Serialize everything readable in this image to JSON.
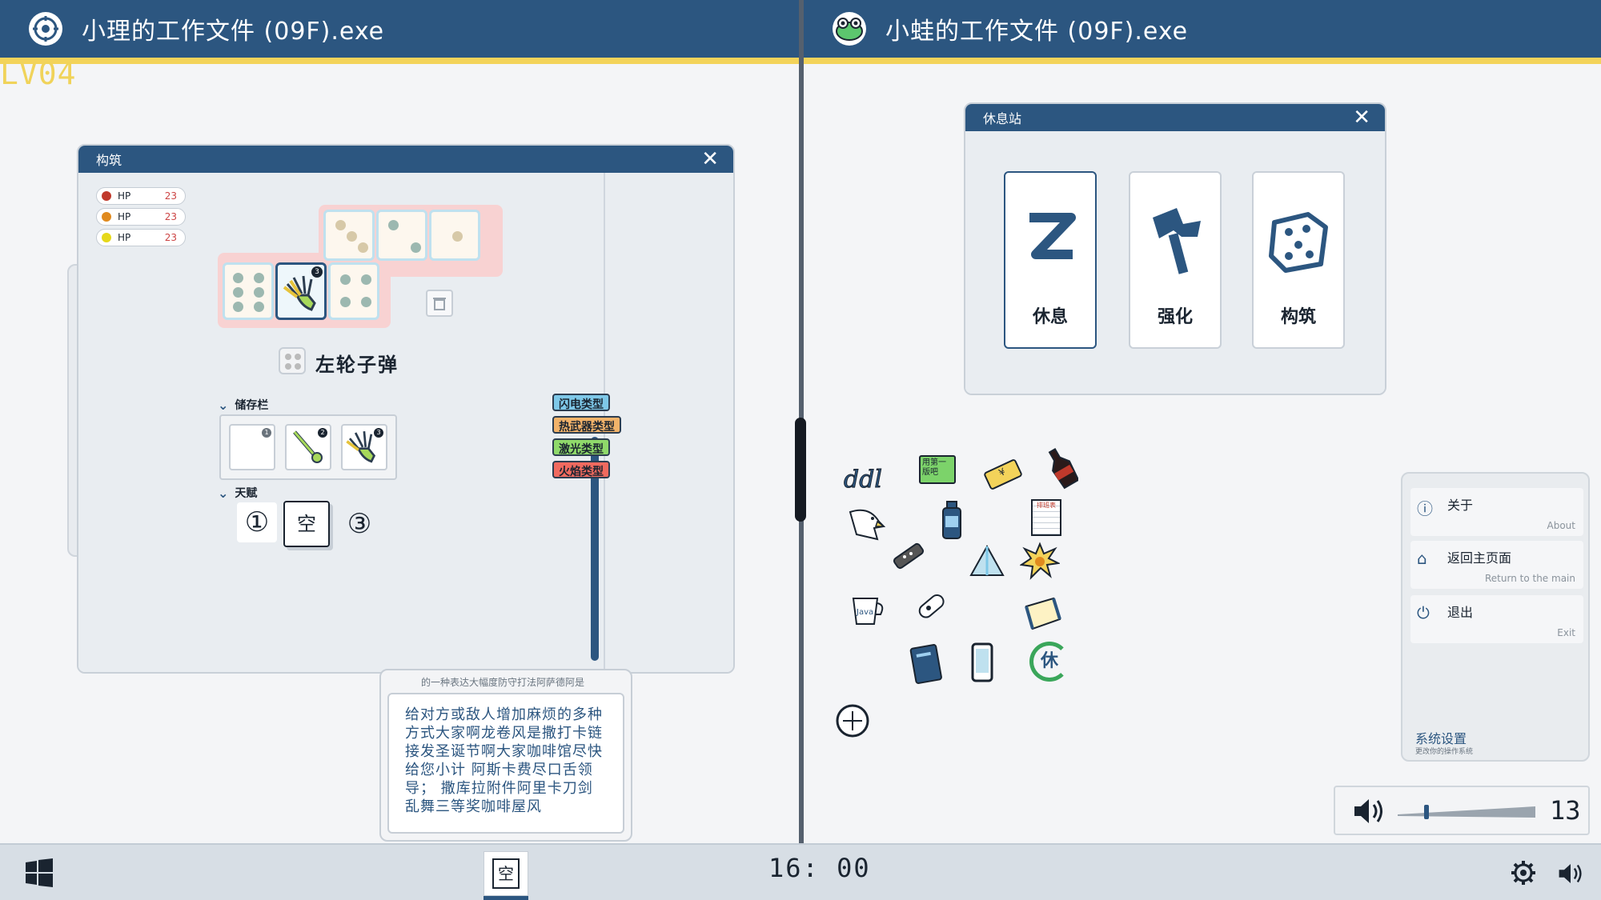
{
  "left_window": {
    "title": "小理的工作文件 (09F).exe",
    "level": "LV04"
  },
  "right_window": {
    "title": "小蛙的工作文件 (09F).exe"
  },
  "construct_panel": {
    "title": "构筑",
    "stats": [
      {
        "label": "HP",
        "value": "23",
        "color": "#c0392b"
      },
      {
        "label": "HP",
        "value": "23",
        "color": "#e08a1e"
      },
      {
        "label": "HP",
        "value": "23",
        "color": "#e6d81a"
      }
    ],
    "grid_badge": "3",
    "item_name": "左轮子弹",
    "tags": [
      {
        "label": "闪电类型",
        "bg": "#7ec8e8"
      },
      {
        "label": "热武器类型",
        "bg": "#f2b36a"
      },
      {
        "label": "激光类型",
        "bg": "#8fd96a"
      },
      {
        "label": "火焰类型",
        "bg": "#f06a5f"
      }
    ],
    "storage": {
      "label": "储存栏",
      "slots": [
        "1",
        "2",
        "3"
      ]
    },
    "talent": {
      "label": "天赋",
      "slots": [
        "①",
        "空",
        "③"
      ]
    }
  },
  "description": {
    "subtitle": "的一种表达大幅度防守打法阿萨德阿是",
    "text": "给对方或敌人增加麻烦的多种方式大家啊龙卷风是撒打卡链接发圣诞节啊大家咖啡馆尽快给您小计 阿斯卡费尽口舌领导； 撒库拉附件阿里卡刀剑乱舞三等奖咖啡屋风"
  },
  "rest_station": {
    "title": "休息站",
    "cards": [
      {
        "label": "休息",
        "icon": "z-icon"
      },
      {
        "label": "强化",
        "icon": "hammer-icon"
      },
      {
        "label": "构筑",
        "icon": "dice-icon"
      }
    ]
  },
  "desktop_icons": {
    "sticker_note": "用第一版吧",
    "ticket": "¥",
    "receipt": "排班表",
    "cup": "Java",
    "rest_badge": "休"
  },
  "system_menu": {
    "items": [
      {
        "title": "关于",
        "subtitle": "About",
        "icon": "info-icon"
      },
      {
        "title": "返回主页面",
        "subtitle": "Return to the main",
        "icon": "home-icon"
      },
      {
        "title": "退出",
        "subtitle": "Exit",
        "icon": "power-icon"
      }
    ],
    "settings_title": "系统设置",
    "settings_subtitle": "更改你的操作系统"
  },
  "volume": {
    "value": "13",
    "level": 0.2
  },
  "taskbar": {
    "clock": "16: 00",
    "app_label": "空"
  },
  "colors": {
    "accent": "#2c5680",
    "highlight": "#f3d35a"
  }
}
